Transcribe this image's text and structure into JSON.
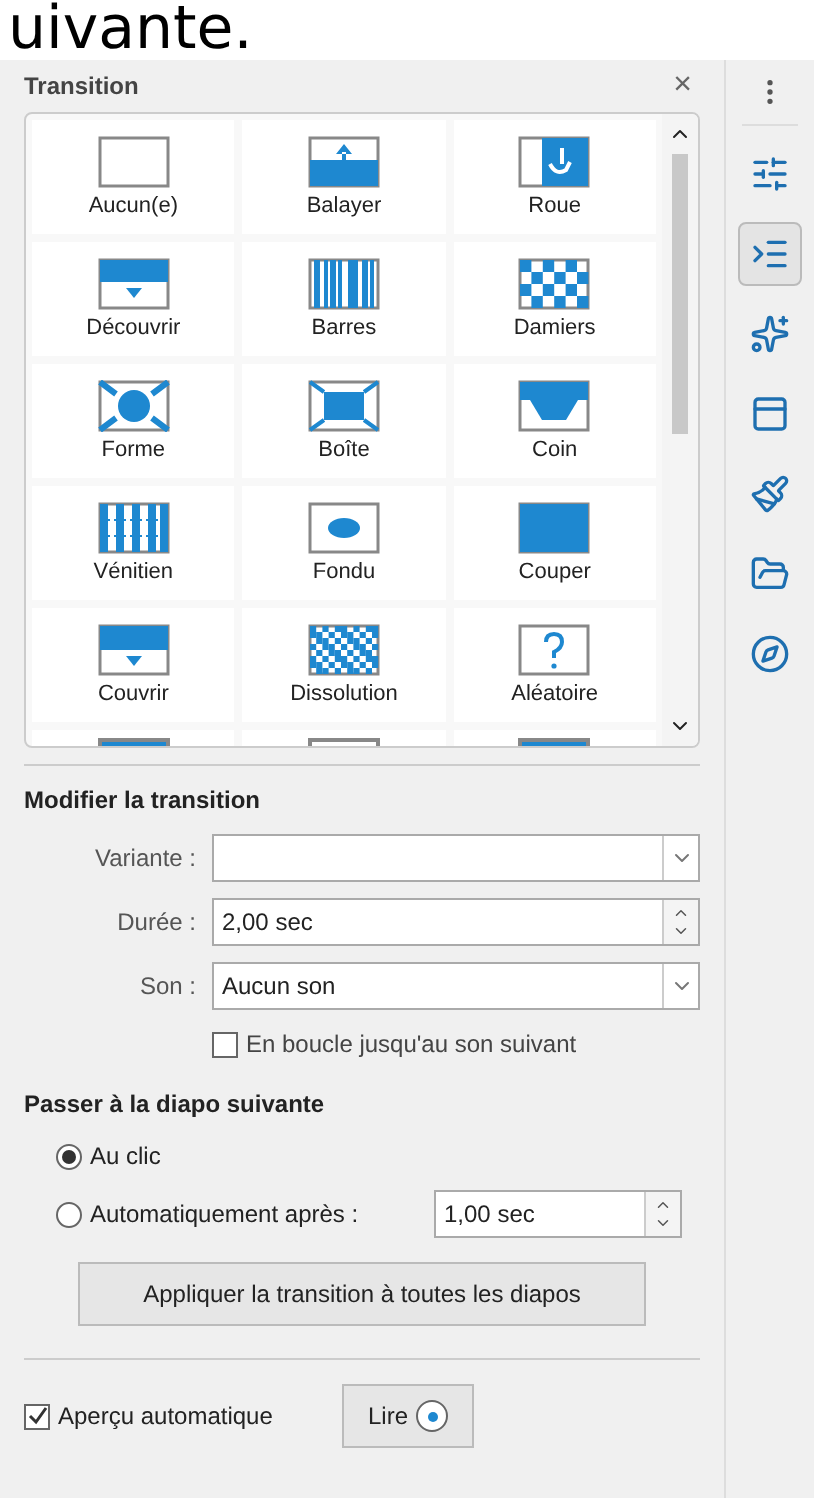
{
  "overlay_text": "uivante.",
  "panel": {
    "title": "Transition",
    "close": "×"
  },
  "transitions": [
    {
      "kind": "none",
      "label": "Aucun(e)",
      "selected": false
    },
    {
      "kind": "wipe",
      "label": "Balayer",
      "selected": false
    },
    {
      "kind": "wheel",
      "label": "Roue",
      "selected": false
    },
    {
      "kind": "uncover",
      "label": "Découvrir",
      "selected": false
    },
    {
      "kind": "bars",
      "label": "Barres",
      "selected": false
    },
    {
      "kind": "checkerboard",
      "label": "Damiers",
      "selected": false
    },
    {
      "kind": "shape",
      "label": "Forme",
      "selected": false
    },
    {
      "kind": "box",
      "label": "Boîte",
      "selected": false
    },
    {
      "kind": "corner",
      "label": "Coin",
      "selected": false
    },
    {
      "kind": "venetian",
      "label": "Vénitien",
      "selected": false
    },
    {
      "kind": "fade",
      "label": "Fondu",
      "selected": false
    },
    {
      "kind": "cut",
      "label": "Couper",
      "selected": false
    },
    {
      "kind": "cover",
      "label": "Couvrir",
      "selected": false
    },
    {
      "kind": "dissolve",
      "label": "Dissolution",
      "selected": false
    },
    {
      "kind": "random",
      "label": "Aléatoire",
      "selected": false
    }
  ],
  "modify": {
    "heading": "Modifier la transition",
    "variant": {
      "label": "Variante :"
    },
    "duration": {
      "label": "Durée :",
      "value": "2,00 sec"
    },
    "sound": {
      "label": "Son :",
      "value": "Aucun son"
    },
    "loop": {
      "label": "En boucle jusqu'au son suivant",
      "checked": false
    }
  },
  "advance": {
    "heading": "Passer à la diapo suivante",
    "options": [
      {
        "label": "Au clic",
        "selected": true
      },
      {
        "label": "Automatiquement après :",
        "selected": false
      }
    ],
    "delay": "1,00 sec",
    "apply_button": "Appliquer la transition à toutes les diapos"
  },
  "footer": {
    "preview": {
      "label": "Aperçu automatique",
      "checked": true
    },
    "play_button": "Lire"
  },
  "sidebar_tabs": [
    {
      "kind": "properties",
      "selected": false
    },
    {
      "kind": "transition",
      "selected": true
    },
    {
      "kind": "animation",
      "selected": false
    },
    {
      "kind": "master",
      "selected": false
    },
    {
      "kind": "styles",
      "selected": false
    },
    {
      "kind": "gallery",
      "selected": false
    },
    {
      "kind": "navigator",
      "selected": false
    }
  ]
}
